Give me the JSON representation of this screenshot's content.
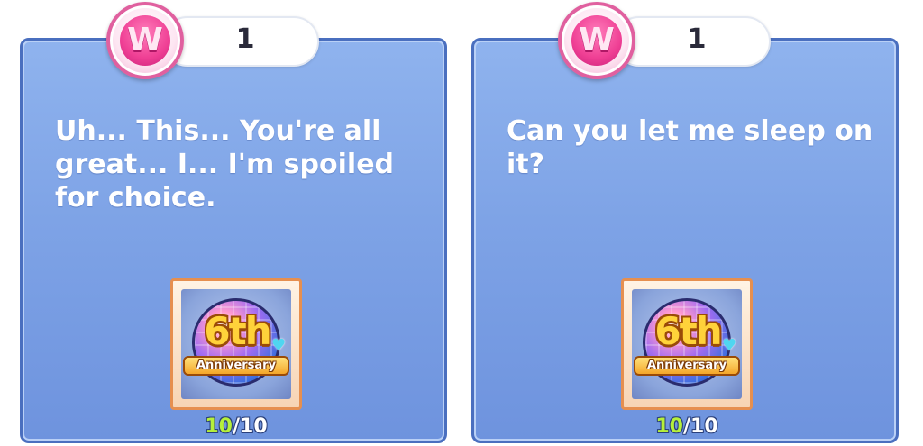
{
  "cards": [
    {
      "badge_letter": "W",
      "count": "1",
      "message": "Uh... This... You're all great... I... I'm spoiled for choice.",
      "item": {
        "number": "6th",
        "banner": "Anniversary",
        "icon": "heart-icon"
      },
      "progress": {
        "current": "10",
        "separator": "/",
        "total": "10"
      }
    },
    {
      "badge_letter": "W",
      "count": "1",
      "message": "Can you let me sleep on it?",
      "item": {
        "number": "6th",
        "banner": "Anniversary",
        "icon": "heart-icon"
      },
      "progress": {
        "current": "10",
        "separator": "/",
        "total": "10"
      }
    }
  ],
  "colors": {
    "card_background": "#7ea3e6",
    "card_border": "#4a6fbf",
    "badge_pink": "#ef3f94",
    "progress_current": "#b6f03a",
    "item_frame": "#e68f4f"
  }
}
